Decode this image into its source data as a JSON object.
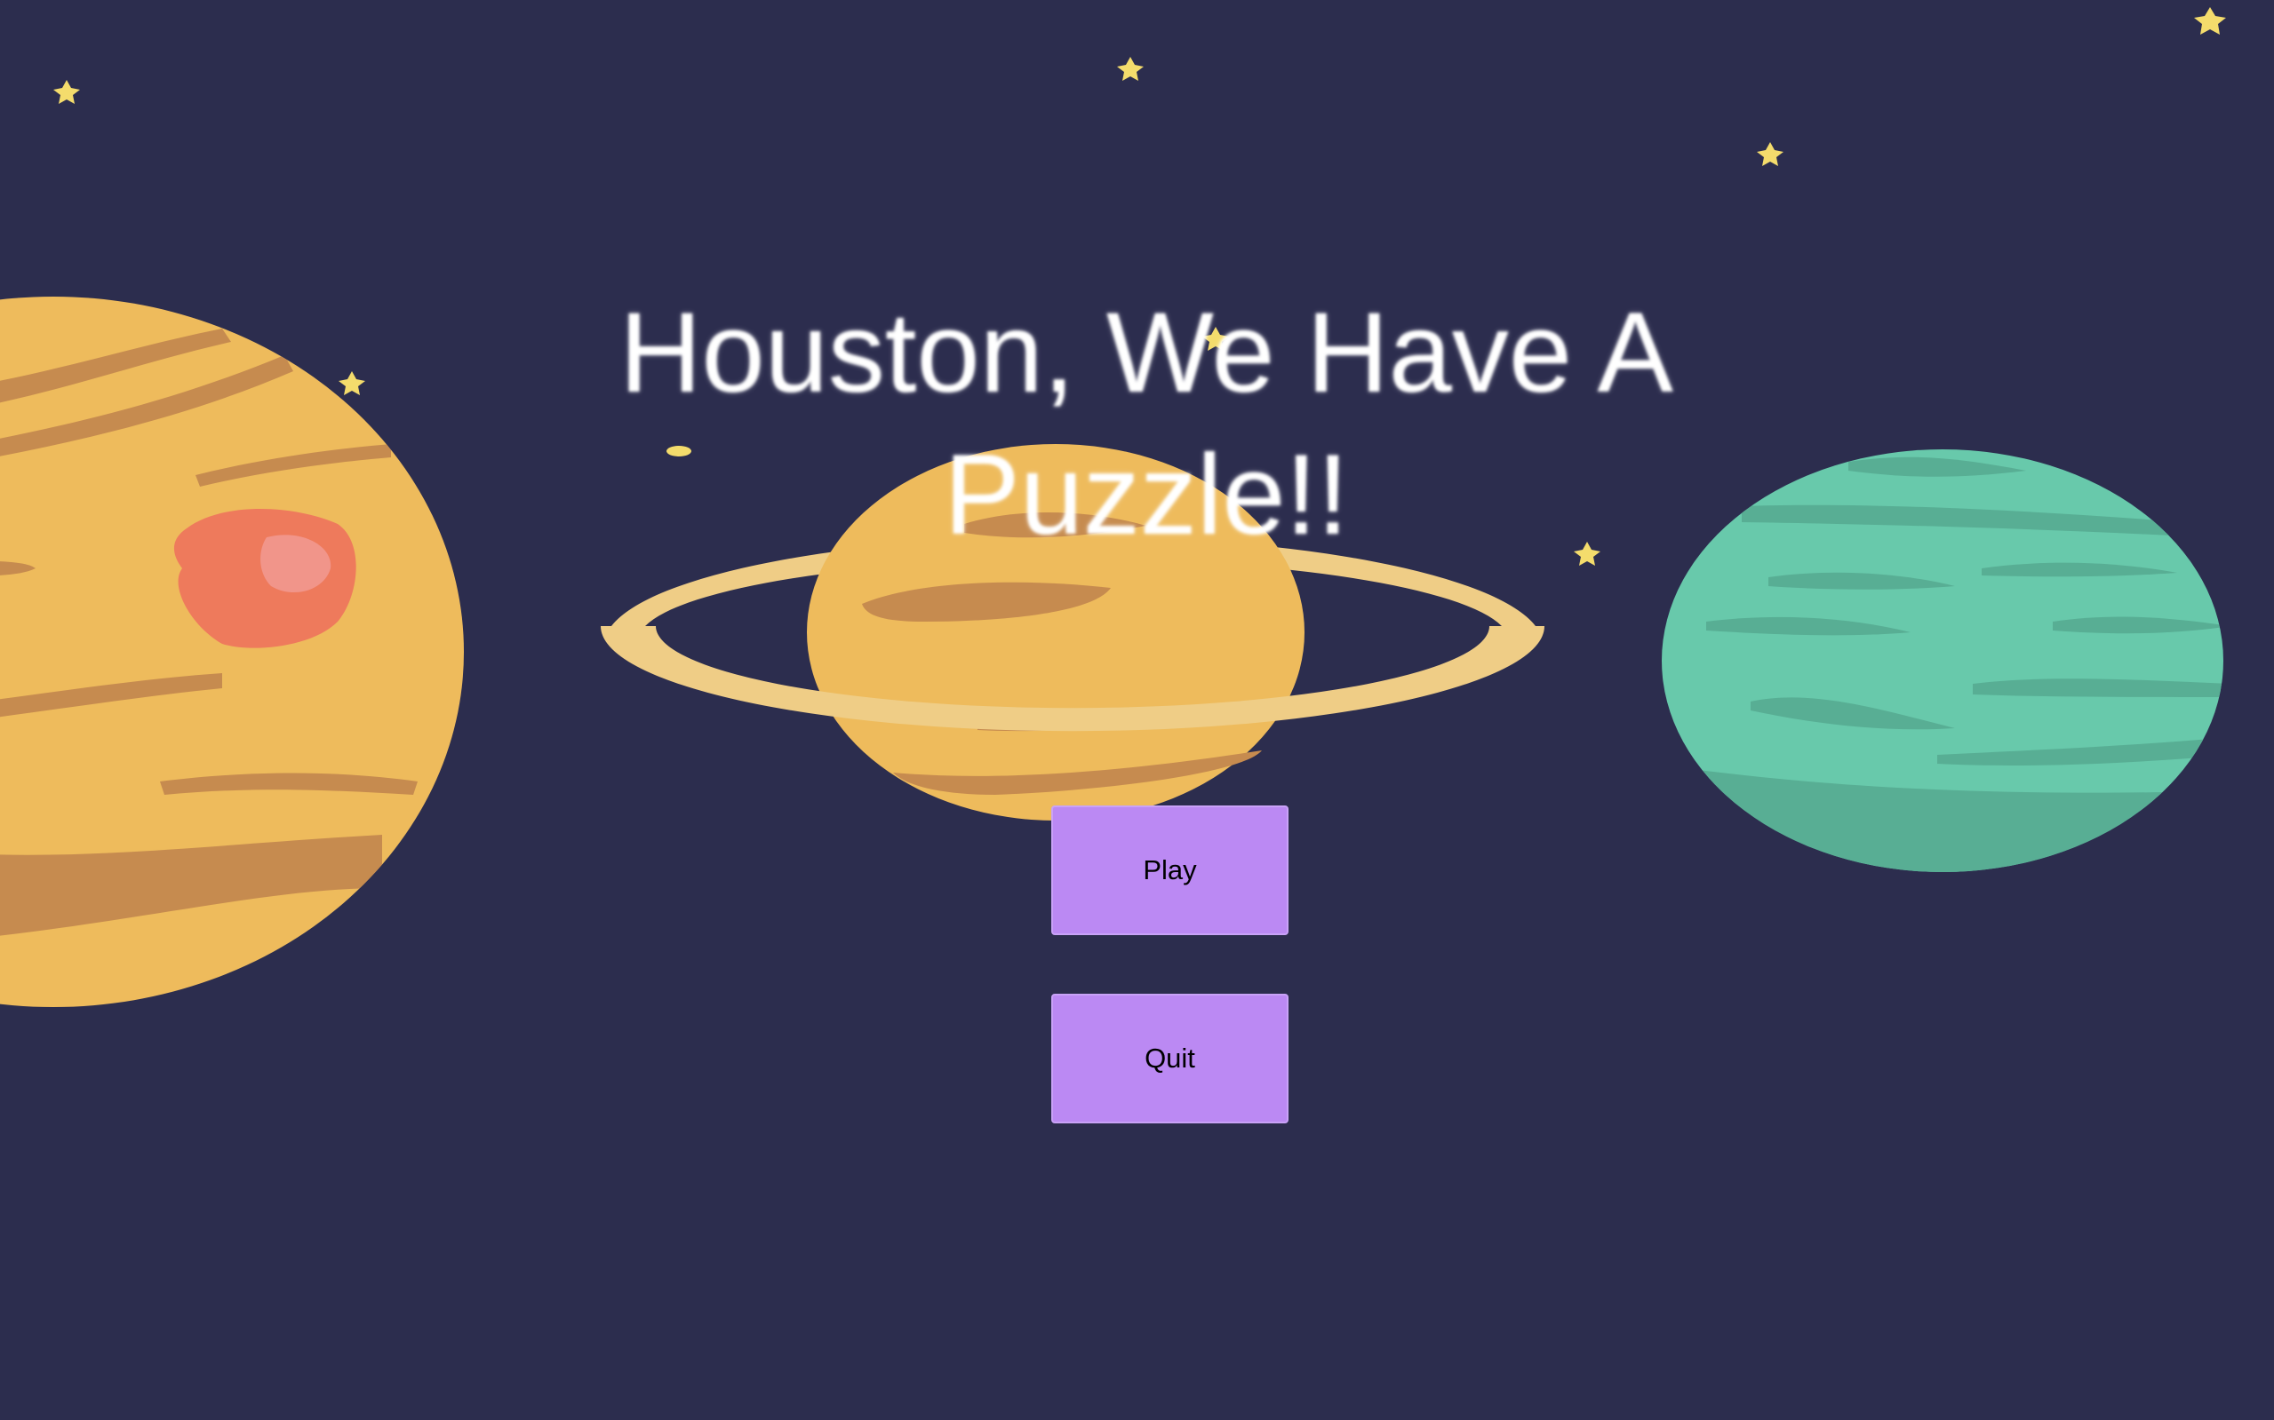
{
  "title": {
    "line1": "Houston, We Have A",
    "line2": "Puzzle!!"
  },
  "menu": {
    "play_label": "Play",
    "quit_label": "Quit"
  },
  "colors": {
    "background": "#2c2d4e",
    "button": "#bb89f3",
    "planet_yellow": "#eebb5c",
    "planet_band": "#c68b4f",
    "planet_teal": "#68c9ab",
    "ring": "#efcd86",
    "spot": "#ee7a5c",
    "star": "#f4dc6c",
    "title_text": "#ffffff"
  },
  "icons": {
    "star": "star-icon",
    "planet_left": "gas-giant-with-spot",
    "planet_center": "ringed-planet",
    "planet_right": "teal-planet"
  }
}
